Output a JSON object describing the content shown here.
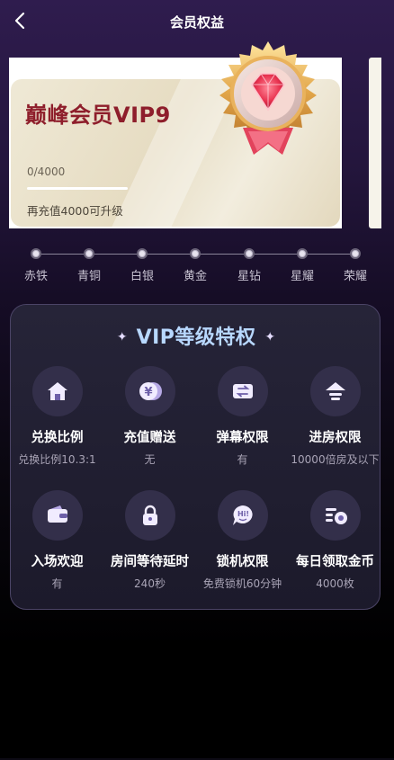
{
  "header": {
    "title": "会员权益"
  },
  "card": {
    "title": "巅峰会员VIP9",
    "progress_text": "0/4000",
    "progress_fraction": 0,
    "hint": "再充值4000可升级"
  },
  "levels": [
    "赤铁",
    "青铜",
    "白银",
    "黄金",
    "星钻",
    "星耀",
    "荣耀"
  ],
  "privileges": {
    "title": "VIP等级特权",
    "items": [
      {
        "name": "兑换比例",
        "value": "兑换比例10.3:1",
        "icon": "home-icon"
      },
      {
        "name": "充值赠送",
        "value": "无",
        "icon": "yen-coin-icon"
      },
      {
        "name": "弹幕权限",
        "value": "有",
        "icon": "danmaku-icon"
      },
      {
        "name": "进房权限",
        "value": "10000倍房及以下",
        "icon": "enter-room-icon"
      },
      {
        "name": "入场欢迎",
        "value": "有",
        "icon": "wallet-icon"
      },
      {
        "name": "房间等待延时",
        "value": "240秒",
        "icon": "lock-icon"
      },
      {
        "name": "锁机权限",
        "value": "免费锁机60分钟",
        "icon": "hi-chat-icon"
      },
      {
        "name": "每日领取金币",
        "value": "4000枚",
        "icon": "coin-list-icon"
      }
    ]
  },
  "colors": {
    "accent_title": "#b8d8ff",
    "card_title": "#8e1e2b",
    "icon_fill": "#f1ecff"
  }
}
